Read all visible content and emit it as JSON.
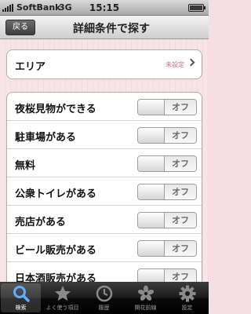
{
  "status": {
    "carrier": "SoftBank",
    "network": "3G",
    "time": "15:15"
  },
  "nav": {
    "back_label": "戻る",
    "title": "詳細条件で探す"
  },
  "area": {
    "label": "エリア",
    "value": "未設定"
  },
  "filters": [
    {
      "label": "夜桜見物ができる",
      "state": "オフ"
    },
    {
      "label": "駐車場がある",
      "state": "オフ"
    },
    {
      "label": "無料",
      "state": "オフ"
    },
    {
      "label": "公衆トイレがある",
      "state": "オフ"
    },
    {
      "label": "売店がある",
      "state": "オフ"
    },
    {
      "label": "ビール販売がある",
      "state": "オフ"
    },
    {
      "label": "日本酒販売がある",
      "state": "オフ"
    }
  ],
  "tabs": [
    {
      "label": "検索",
      "icon": "search-icon"
    },
    {
      "label": "よく使う項目",
      "icon": "star-icon"
    },
    {
      "label": "履歴",
      "icon": "clock-icon"
    },
    {
      "label": "開花前線",
      "icon": "blossom-icon"
    },
    {
      "label": "設定",
      "icon": "gear-icon"
    }
  ],
  "colors": {
    "accent_pink": "#d4677a",
    "background": "#f6dfe3"
  }
}
